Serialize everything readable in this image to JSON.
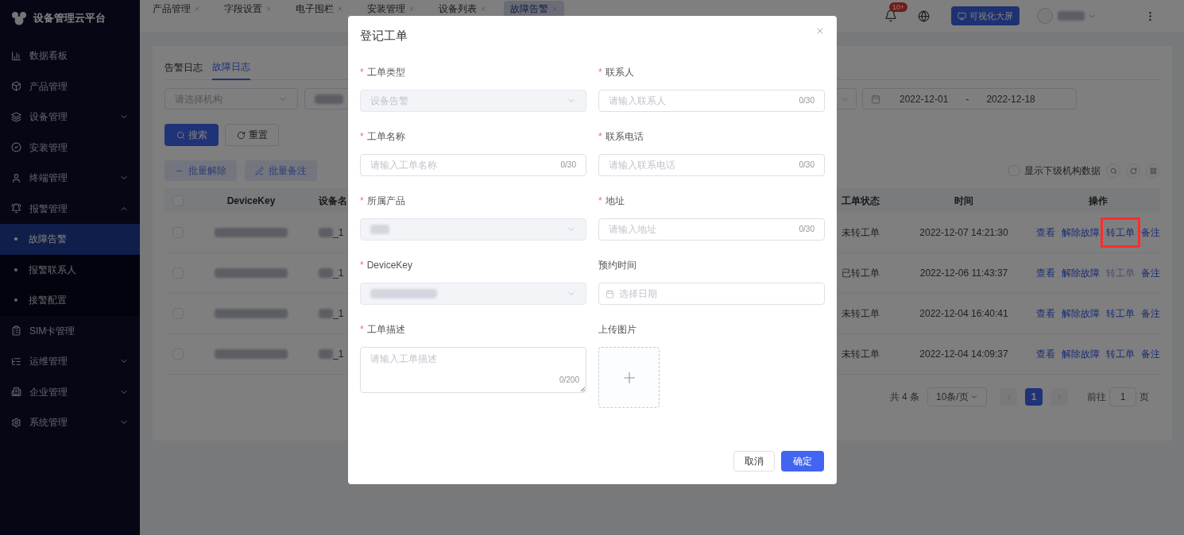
{
  "sidebar": {
    "brand": "设备管理云平台",
    "items": [
      {
        "label": "数据看板",
        "expandable": false,
        "selected": false
      },
      {
        "label": "产品管理",
        "expandable": false,
        "selected": false
      },
      {
        "label": "设备管理",
        "expandable": true,
        "expanded": false,
        "selected": false
      },
      {
        "label": "安装管理",
        "expandable": false,
        "selected": false
      },
      {
        "label": "终端管理",
        "expandable": true,
        "expanded": false,
        "selected": false
      },
      {
        "label": "报警管理",
        "expandable": true,
        "expanded": true,
        "selected": false,
        "children": [
          {
            "label": "故障告警",
            "selected": true
          },
          {
            "label": "报警联系人",
            "selected": false
          },
          {
            "label": "接警配置",
            "selected": false
          }
        ]
      },
      {
        "label": "SIM卡管理",
        "expandable": false,
        "selected": false
      },
      {
        "label": "运维管理",
        "expandable": true,
        "expanded": false,
        "selected": false
      },
      {
        "label": "企业管理",
        "expandable": true,
        "expanded": false,
        "selected": false
      },
      {
        "label": "系统管理",
        "expandable": true,
        "expanded": false,
        "selected": false
      }
    ]
  },
  "header": {
    "tabs": [
      {
        "label": "产品管理",
        "selected": false
      },
      {
        "label": "字段设置",
        "selected": false
      },
      {
        "label": "电子围栏",
        "selected": false
      },
      {
        "label": "安装管理",
        "selected": false
      },
      {
        "label": "设备列表",
        "selected": false
      },
      {
        "label": "故障告警",
        "selected": true
      }
    ],
    "notification_badge": "10+",
    "screen_button": "可视化大屏"
  },
  "page": {
    "tabs": [
      {
        "label": "告警日志",
        "selected": false
      },
      {
        "label": "故障日志",
        "selected": true
      }
    ],
    "filters": {
      "org_placeholder": "请选择机构",
      "date_start": "2022-12-01",
      "date_separator": "-",
      "date_end": "2022-12-18"
    },
    "buttons": {
      "search": "搜索",
      "reset": "重置",
      "batch_resolve": "批量解除",
      "batch_note": "批量备注"
    },
    "sub_org_toggle": {
      "label": "显示下级机构数据",
      "checked": false
    },
    "table": {
      "columns": [
        "DeviceKey",
        "设备名",
        "工单状态",
        "时间",
        "操作"
      ],
      "header_checked": false,
      "rows": [
        {
          "checked": false,
          "device_name_suffix": "_1",
          "status": "未转工单",
          "time": "2022-12-07 14:21:30",
          "actions": [
            {
              "label": "查看",
              "disabled": false,
              "highlighted": false
            },
            {
              "label": "解除故障",
              "disabled": false,
              "highlighted": false
            },
            {
              "label": "转工单",
              "disabled": false,
              "highlighted": true
            },
            {
              "label": "备注",
              "disabled": false,
              "highlighted": false
            }
          ]
        },
        {
          "checked": false,
          "device_name_suffix": "_1",
          "status": "已转工单",
          "time": "2022-12-06 11:43:37",
          "actions": [
            {
              "label": "查看",
              "disabled": false,
              "highlighted": false
            },
            {
              "label": "解除故障",
              "disabled": false,
              "highlighted": false
            },
            {
              "label": "转工单",
              "disabled": true,
              "highlighted": false
            },
            {
              "label": "备注",
              "disabled": false,
              "highlighted": false
            }
          ]
        },
        {
          "checked": false,
          "device_name_suffix": "_1",
          "status": "未转工单",
          "time": "2022-12-04 16:40:41",
          "actions": [
            {
              "label": "查看",
              "disabled": false,
              "highlighted": false
            },
            {
              "label": "解除故障",
              "disabled": false,
              "highlighted": false
            },
            {
              "label": "转工单",
              "disabled": false,
              "highlighted": false
            },
            {
              "label": "备注",
              "disabled": false,
              "highlighted": false
            }
          ]
        },
        {
          "checked": false,
          "device_name_suffix": "_1",
          "status": "未转工单",
          "time": "2022-12-04 14:09:37",
          "actions": [
            {
              "label": "查看",
              "disabled": false,
              "highlighted": false
            },
            {
              "label": "解除故障",
              "disabled": false,
              "highlighted": false
            },
            {
              "label": "转工单",
              "disabled": false,
              "highlighted": false
            },
            {
              "label": "备注",
              "disabled": false,
              "highlighted": false
            }
          ]
        }
      ]
    },
    "pagination": {
      "total": "共 4 条",
      "page_size": "10条/页",
      "pages": [
        {
          "label": "1",
          "selected": true
        }
      ],
      "goto_label": "前往",
      "goto_value": "1",
      "goto_suffix": "页"
    }
  },
  "dialog": {
    "title": "登记工单",
    "fields": [
      {
        "kind": "select",
        "required_mark": "*",
        "label": "工单类型",
        "disabled": true,
        "value": "设备告警"
      },
      {
        "kind": "input",
        "required_mark": "*",
        "label": "联系人",
        "placeholder": "请输入联系人",
        "counter": "0/30"
      },
      {
        "kind": "input",
        "required_mark": "*",
        "label": "工单名称",
        "placeholder": "请输入工单名称",
        "counter": "0/30"
      },
      {
        "kind": "input",
        "required_mark": "*",
        "label": "联系电话",
        "placeholder": "请输入联系电话",
        "counter": "0/30"
      },
      {
        "kind": "select",
        "required_mark": "*",
        "label": "所属产品",
        "disabled": true
      },
      {
        "kind": "input",
        "required_mark": "*",
        "label": "地址",
        "placeholder": "请输入地址",
        "counter": "0/30"
      },
      {
        "kind": "select",
        "required_mark": "*",
        "label": "DeviceKey",
        "disabled": true
      },
      {
        "kind": "date",
        "label": "预约时间",
        "placeholder": "选择日期"
      },
      {
        "kind": "textarea",
        "required_mark": "*",
        "label": "工单描述",
        "placeholder": "请输入工单描述",
        "counter": "0/200"
      },
      {
        "kind": "upload",
        "label": "上传图片"
      }
    ],
    "cancel": "取消",
    "confirm": "确定"
  }
}
